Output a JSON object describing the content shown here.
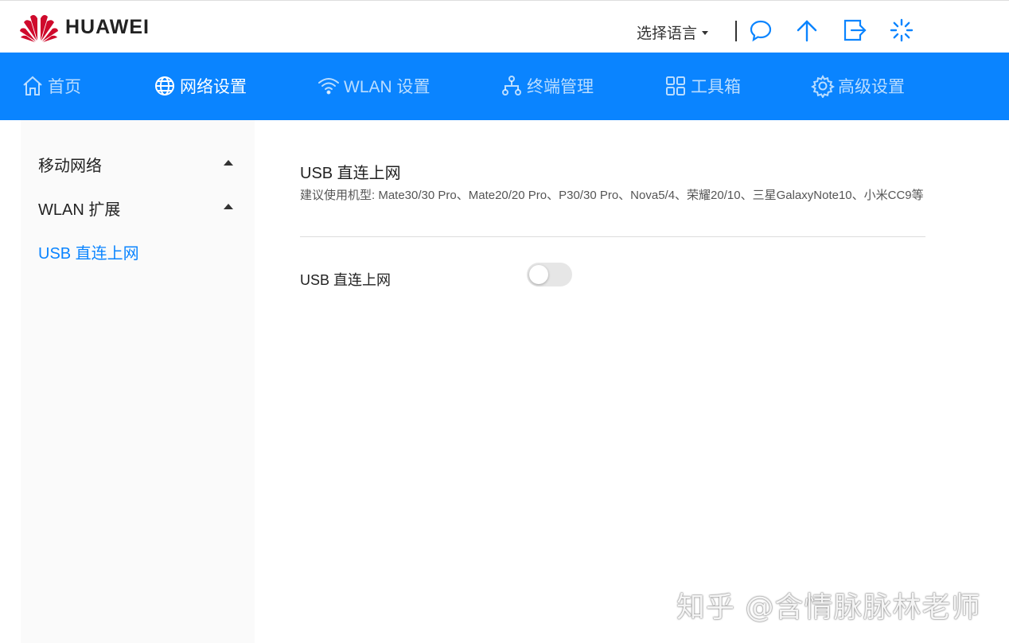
{
  "brand": {
    "name": "HUAWEI",
    "color": "#cf0a2c"
  },
  "header": {
    "language_label": "选择语言",
    "icons": [
      "message-icon",
      "upload-icon",
      "logout-icon",
      "loading-icon"
    ]
  },
  "nav": {
    "accent": "#0a84ff",
    "items": [
      {
        "label": "首页",
        "icon": "home-icon",
        "active": false
      },
      {
        "label": "网络设置",
        "icon": "globe-icon",
        "active": true
      },
      {
        "label": "WLAN 设置",
        "icon": "wifi-icon",
        "active": false
      },
      {
        "label": "终端管理",
        "icon": "devices-icon",
        "active": false
      },
      {
        "label": "工具箱",
        "icon": "grid-icon",
        "active": false
      },
      {
        "label": "高级设置",
        "icon": "gear-icon",
        "active": false
      }
    ]
  },
  "sidebar": {
    "items": [
      {
        "label": "移动网络",
        "expandable": true
      },
      {
        "label": "WLAN 扩展",
        "expandable": true
      },
      {
        "label": "USB 直连上网",
        "expandable": false,
        "active": true
      }
    ]
  },
  "main": {
    "title": "USB 直连上网",
    "description": "建议使用机型: Mate30/30 Pro、Mate20/20 Pro、P30/30 Pro、Nova5/4、荣耀20/10、三星GalaxyNote10、小米CC9等",
    "setting": {
      "label": "USB 直连上网",
      "enabled": false
    }
  },
  "watermark": "知乎 @含情脉脉林老师"
}
